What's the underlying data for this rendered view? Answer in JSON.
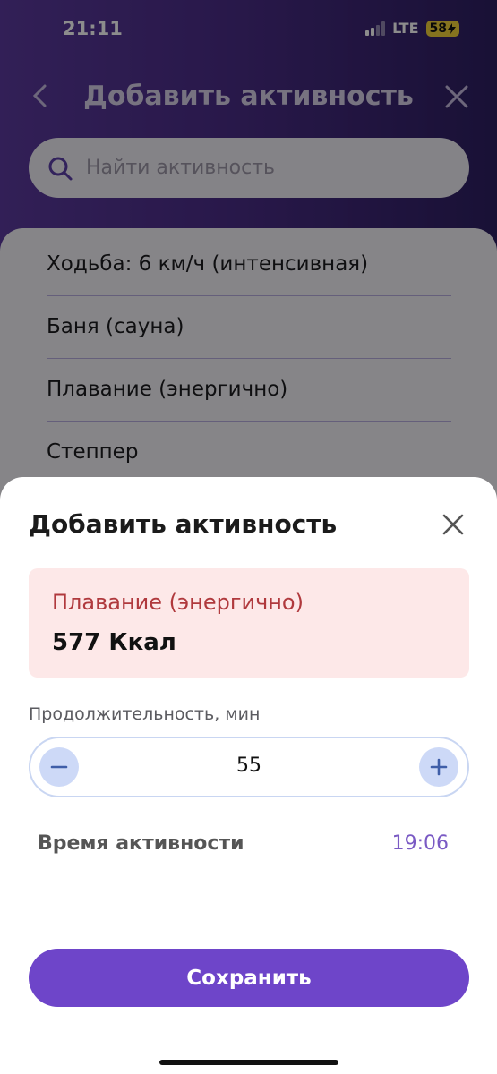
{
  "status_bar": {
    "time": "21:11",
    "network": "LTE",
    "battery": "58"
  },
  "header": {
    "title": "Добавить активность",
    "back_icon": "chevron-left-icon",
    "close_icon": "close-icon"
  },
  "search": {
    "placeholder": "Найти активность",
    "icon": "search-icon"
  },
  "activities": [
    "Ходьба: 6 км/ч (интенсивная)",
    "Баня (сауна)",
    "Плавание (энергично)",
    "Степпер"
  ],
  "sheet": {
    "title": "Добавить активность",
    "selected_activity": "Плавание (энергично)",
    "calories": "577 Ккал",
    "duration_label": "Продолжительность, мин",
    "duration_value": "55",
    "time_label": "Время активности",
    "time_value": "19:06",
    "save_label": "Сохранить"
  },
  "colors": {
    "accent": "#6e45c9",
    "card_bg": "#fde8e8",
    "activity_name": "#b0393d"
  }
}
